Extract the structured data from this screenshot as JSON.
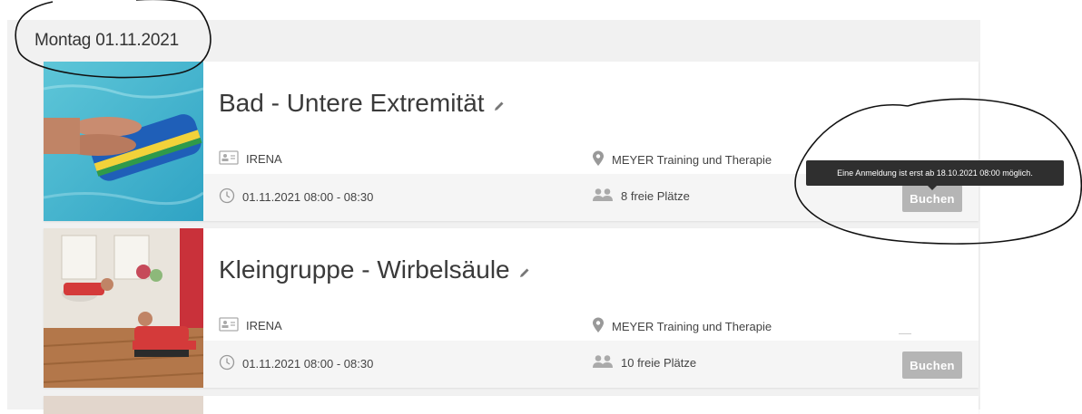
{
  "day": {
    "heading": "Montag 01.11.2021"
  },
  "courses": [
    {
      "title": "Bad - Untere Extremität",
      "trainer": "IRENA",
      "location": "MEYER Training und Therapie",
      "time": "01.11.2021 08:00 - 08:30",
      "spots": "8 freie Plätze",
      "button": "Buchen"
    },
    {
      "title": "Kleingruppe - Wirbelsäule",
      "trainer": "IRENA",
      "location": "MEYER Training und Therapie",
      "time": "01.11.2021 08:00 - 08:30",
      "spots": "10 freie Plätze",
      "button": "Buchen"
    }
  ],
  "tooltip": {
    "text": "Eine Anmeldung ist erst ab 18.10.2021 08:00 möglich."
  },
  "colors": {
    "button_disabled": "#b5b5b5",
    "tooltip_bg": "#2f2f2f",
    "panel_bg": "#f1f1f1"
  }
}
